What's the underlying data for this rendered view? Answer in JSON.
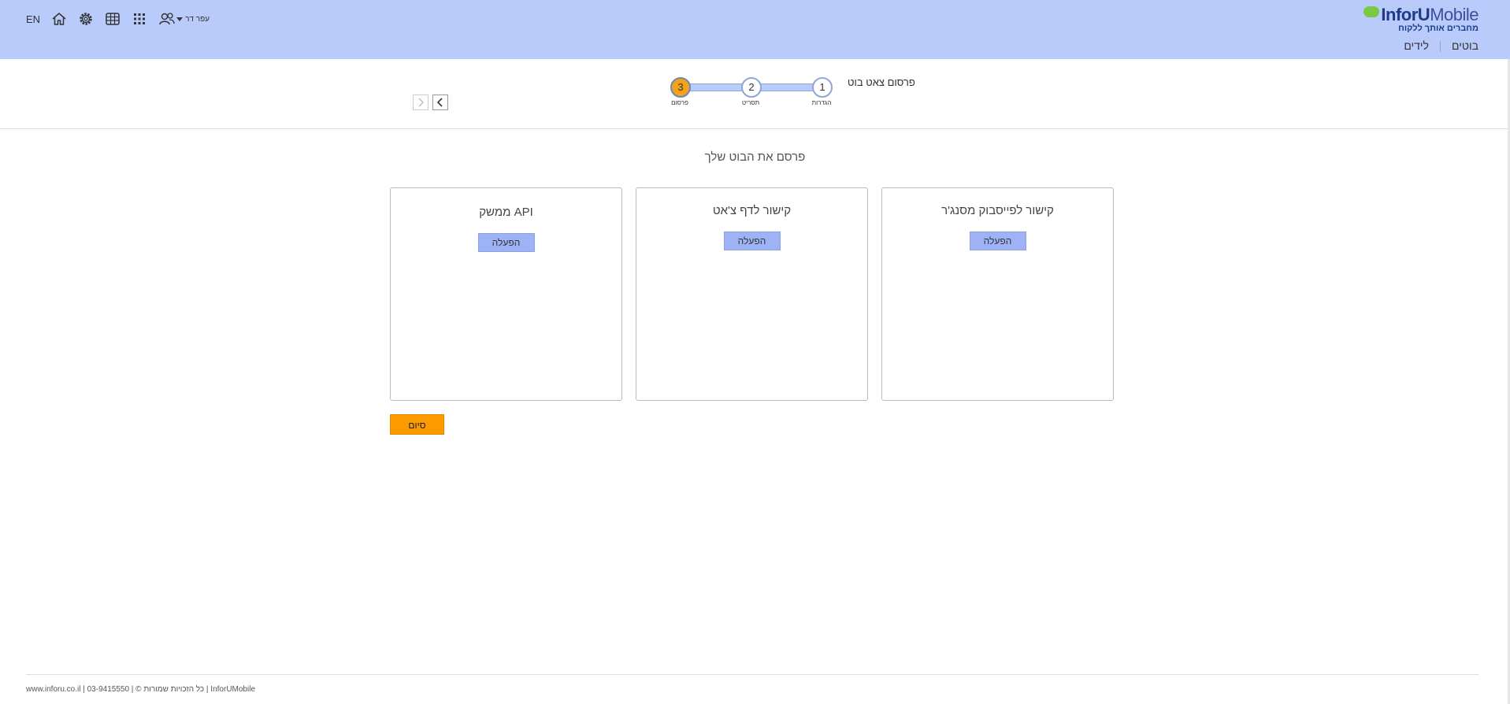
{
  "header": {
    "logo": {
      "name": "InforU",
      "name2": "Mobile",
      "tagline": "מחברים אותך ללקוח"
    },
    "nav": [
      {
        "label": "בוטים"
      },
      {
        "label": "לידים"
      }
    ],
    "lang": "EN",
    "user": "עפר דר"
  },
  "wizard": {
    "title": "פרסום צאט בוט",
    "steps": [
      {
        "number": "1",
        "label": "הגדרות"
      },
      {
        "number": "2",
        "label": "תסריט"
      },
      {
        "number": "3",
        "label": "פרסום"
      }
    ],
    "active_step": 3
  },
  "main": {
    "heading": "פרסם את הבוט שלך",
    "cards": [
      {
        "title": "קישור לפייסבוק מסנג'ר",
        "button": "הפעלה"
      },
      {
        "title": "קישור לדף צ'אט",
        "button": "הפעלה"
      },
      {
        "title": "ממשק API",
        "button": "הפעלה"
      }
    ],
    "finish_button": "סיום"
  },
  "footer": {
    "text": "www.inforu.co.il | 03-9415550 | © כל הזכויות שמורות | InforUMobile"
  },
  "colors": {
    "header_bg": "#b9cbfa",
    "accent": "#fb9b00",
    "button": "#9db3f5"
  }
}
